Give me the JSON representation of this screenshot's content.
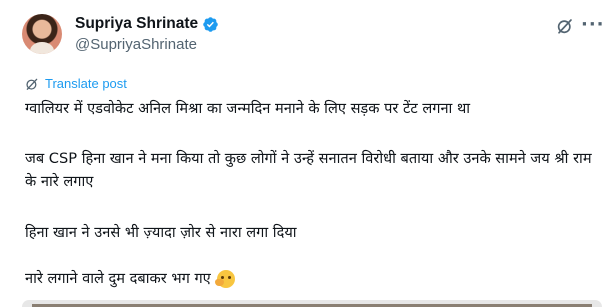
{
  "author": {
    "display_name": "Supriya Shrinate",
    "handle": "@SupriyaShrinate",
    "verified": true,
    "verified_color": "#1d9bf0"
  },
  "header_icons": [
    "grok-icon",
    "more-icon"
  ],
  "translate_label": "Translate post",
  "tweet": {
    "paragraphs": [
      "ग्वालियर में एडवोकेट अनिल मिश्रा का जन्मदिन मनाने के लिए सड़क पर टेंट लगना था",
      "जब CSP हिना खान ने मना किया तो कुछ लोगों ने उन्हें सनातन विरोधी बताया और उनके सामने जय श्री राम के नारे लगाए",
      "हिना खान ने उनसे भी ज़्यादा ज़ोर से नारा लगा दिया",
      "नारे लगाने वाले दुम दबाकर भग गए"
    ],
    "emoji": "face-with-hand-over-mouth"
  },
  "colors": {
    "text": "#0f1419",
    "muted": "#536471",
    "link": "#1d9bf0"
  }
}
